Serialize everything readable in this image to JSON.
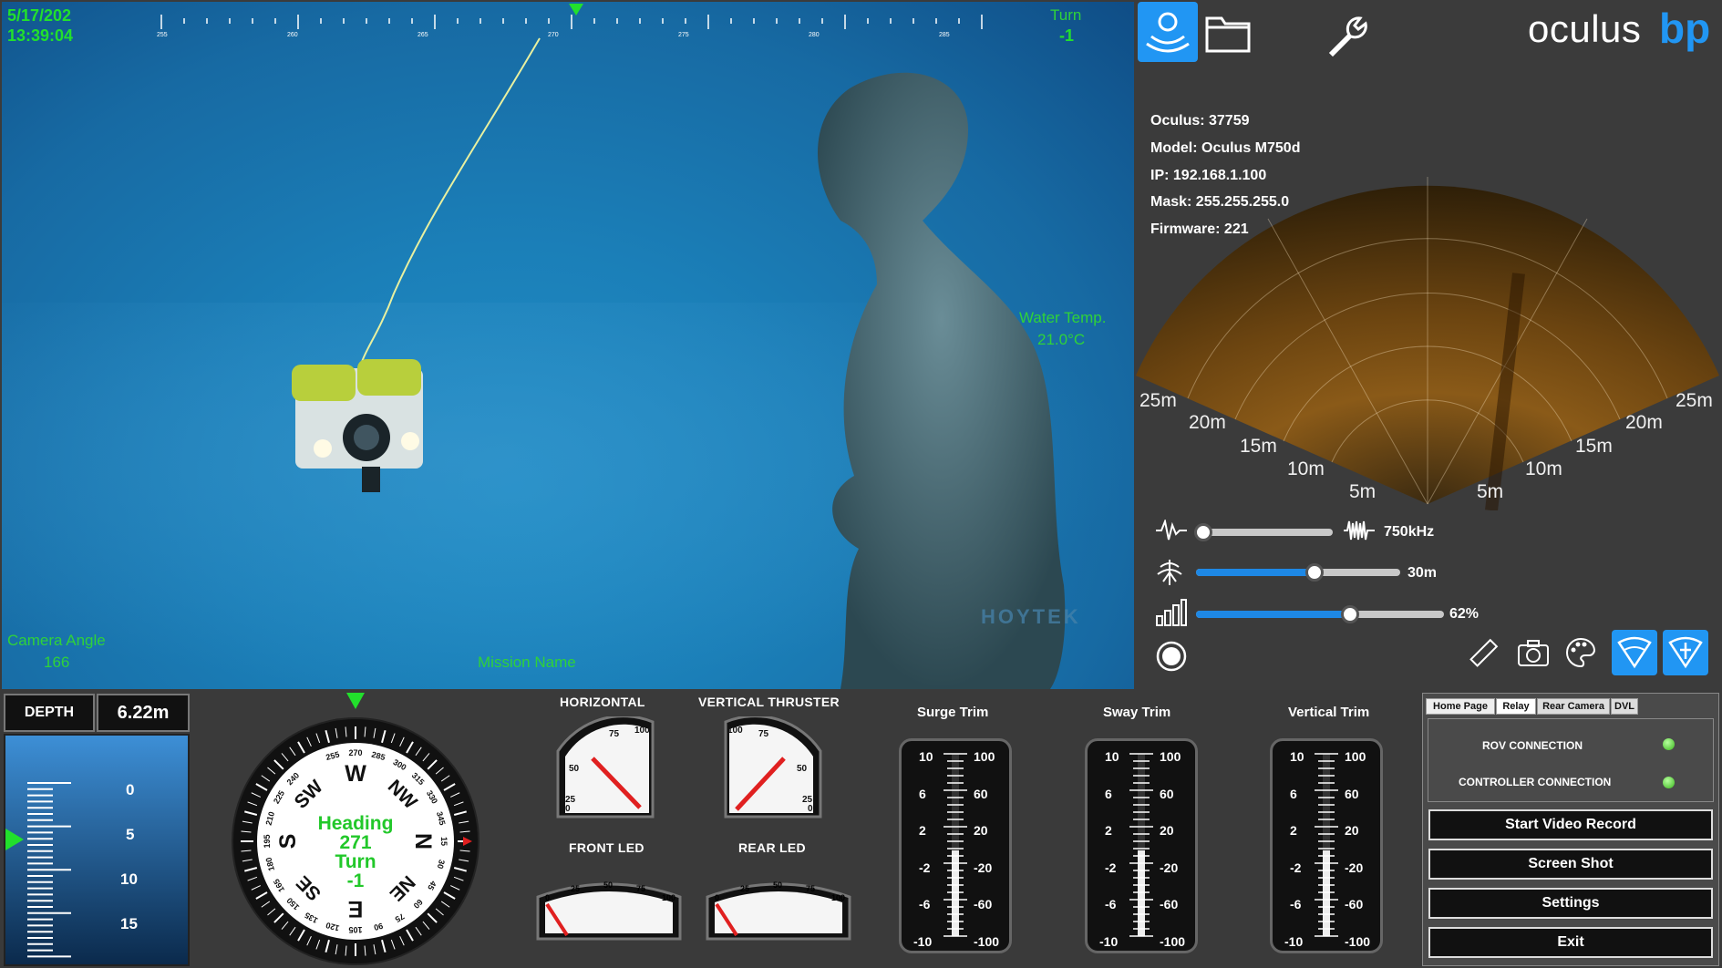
{
  "camera_osd": {
    "date": "5/17/202",
    "time": "13:39:04",
    "turn_label": "Turn",
    "turn_value": "-1",
    "water_temp_label": "Water Temp.",
    "water_temp_value": "21.0°C",
    "camera_angle_label": "Camera Angle",
    "camera_angle_value": "166",
    "mission_name": "Mission Name",
    "watermark": "HOYTEK",
    "heading_ticks": [
      "255",
      "260",
      "265",
      "270",
      "275",
      "280",
      "285"
    ]
  },
  "sonar": {
    "brand": "oculus",
    "brand2": "bp",
    "info": {
      "oculus": "Oculus: 37759",
      "model": "Model: Oculus M750d",
      "ip": "IP: 192.168.1.100",
      "mask": "Mask: 255.255.255.0",
      "firmware": "Firmware: 221"
    },
    "ranges_left": [
      "25m",
      "20m",
      "15m",
      "10m",
      "5m"
    ],
    "ranges_right": [
      "25m",
      "20m",
      "15m",
      "10m",
      "5m"
    ],
    "frequency": {
      "value": "750kHz",
      "level": 0.05
    },
    "range": {
      "value": "30m",
      "level": 0.58
    },
    "gain": {
      "value": "62%",
      "level": 0.62
    }
  },
  "depth": {
    "label": "DEPTH",
    "value": "6.22m",
    "scale": [
      "0",
      "5",
      "10",
      "15"
    ]
  },
  "compass": {
    "heading_label": "Heading",
    "heading_value": "271",
    "turn_label": "Turn",
    "turn_value": "-1",
    "cardinals": [
      "W",
      "NW",
      "N",
      "NE",
      "E",
      "SE",
      "S",
      "SW"
    ],
    "degrees": [
      "255",
      "270",
      "285",
      "300",
      "315",
      "330",
      "345",
      "15",
      "30",
      "45",
      "60",
      "75",
      "90",
      "105",
      "120",
      "135",
      "150",
      "165",
      "180",
      "195",
      "210",
      "225",
      "240"
    ]
  },
  "gauges": {
    "horizontal": "HORIZONTAL",
    "vertical": "VERTICAL THRUSTER",
    "front_led": "FRONT LED",
    "rear_led": "REAR LED",
    "gauge_nums": [
      "0",
      "25",
      "50",
      "75",
      "100"
    ]
  },
  "trims": [
    {
      "title": "Surge Trim",
      "left": [
        "10",
        "6",
        "2",
        "-2",
        "-6",
        "-10"
      ],
      "right": [
        "100",
        "60",
        "20",
        "-20",
        "-60",
        "-100"
      ]
    },
    {
      "title": "Sway Trim",
      "left": [
        "10",
        "6",
        "2",
        "-2",
        "-6",
        "-10"
      ],
      "right": [
        "100",
        "60",
        "20",
        "-20",
        "-60",
        "-100"
      ]
    },
    {
      "title": "Vertical Trim",
      "left": [
        "10",
        "6",
        "2",
        "-2",
        "-6",
        "-10"
      ],
      "right": [
        "100",
        "60",
        "20",
        "-20",
        "-60",
        "-100"
      ]
    }
  ],
  "control": {
    "tabs": [
      "Home Page",
      "Relay",
      "Rear Camera",
      "DVL"
    ],
    "rov_connection": "ROV CONNECTION",
    "controller_connection": "CONTROLLER CONNECTION",
    "start_video": "Start Video Record",
    "screenshot": "Screen Shot",
    "settings": "Settings",
    "exit": "Exit"
  },
  "colors": {
    "osd_green": "#22e02c",
    "accent_blue": "#2196f3"
  }
}
